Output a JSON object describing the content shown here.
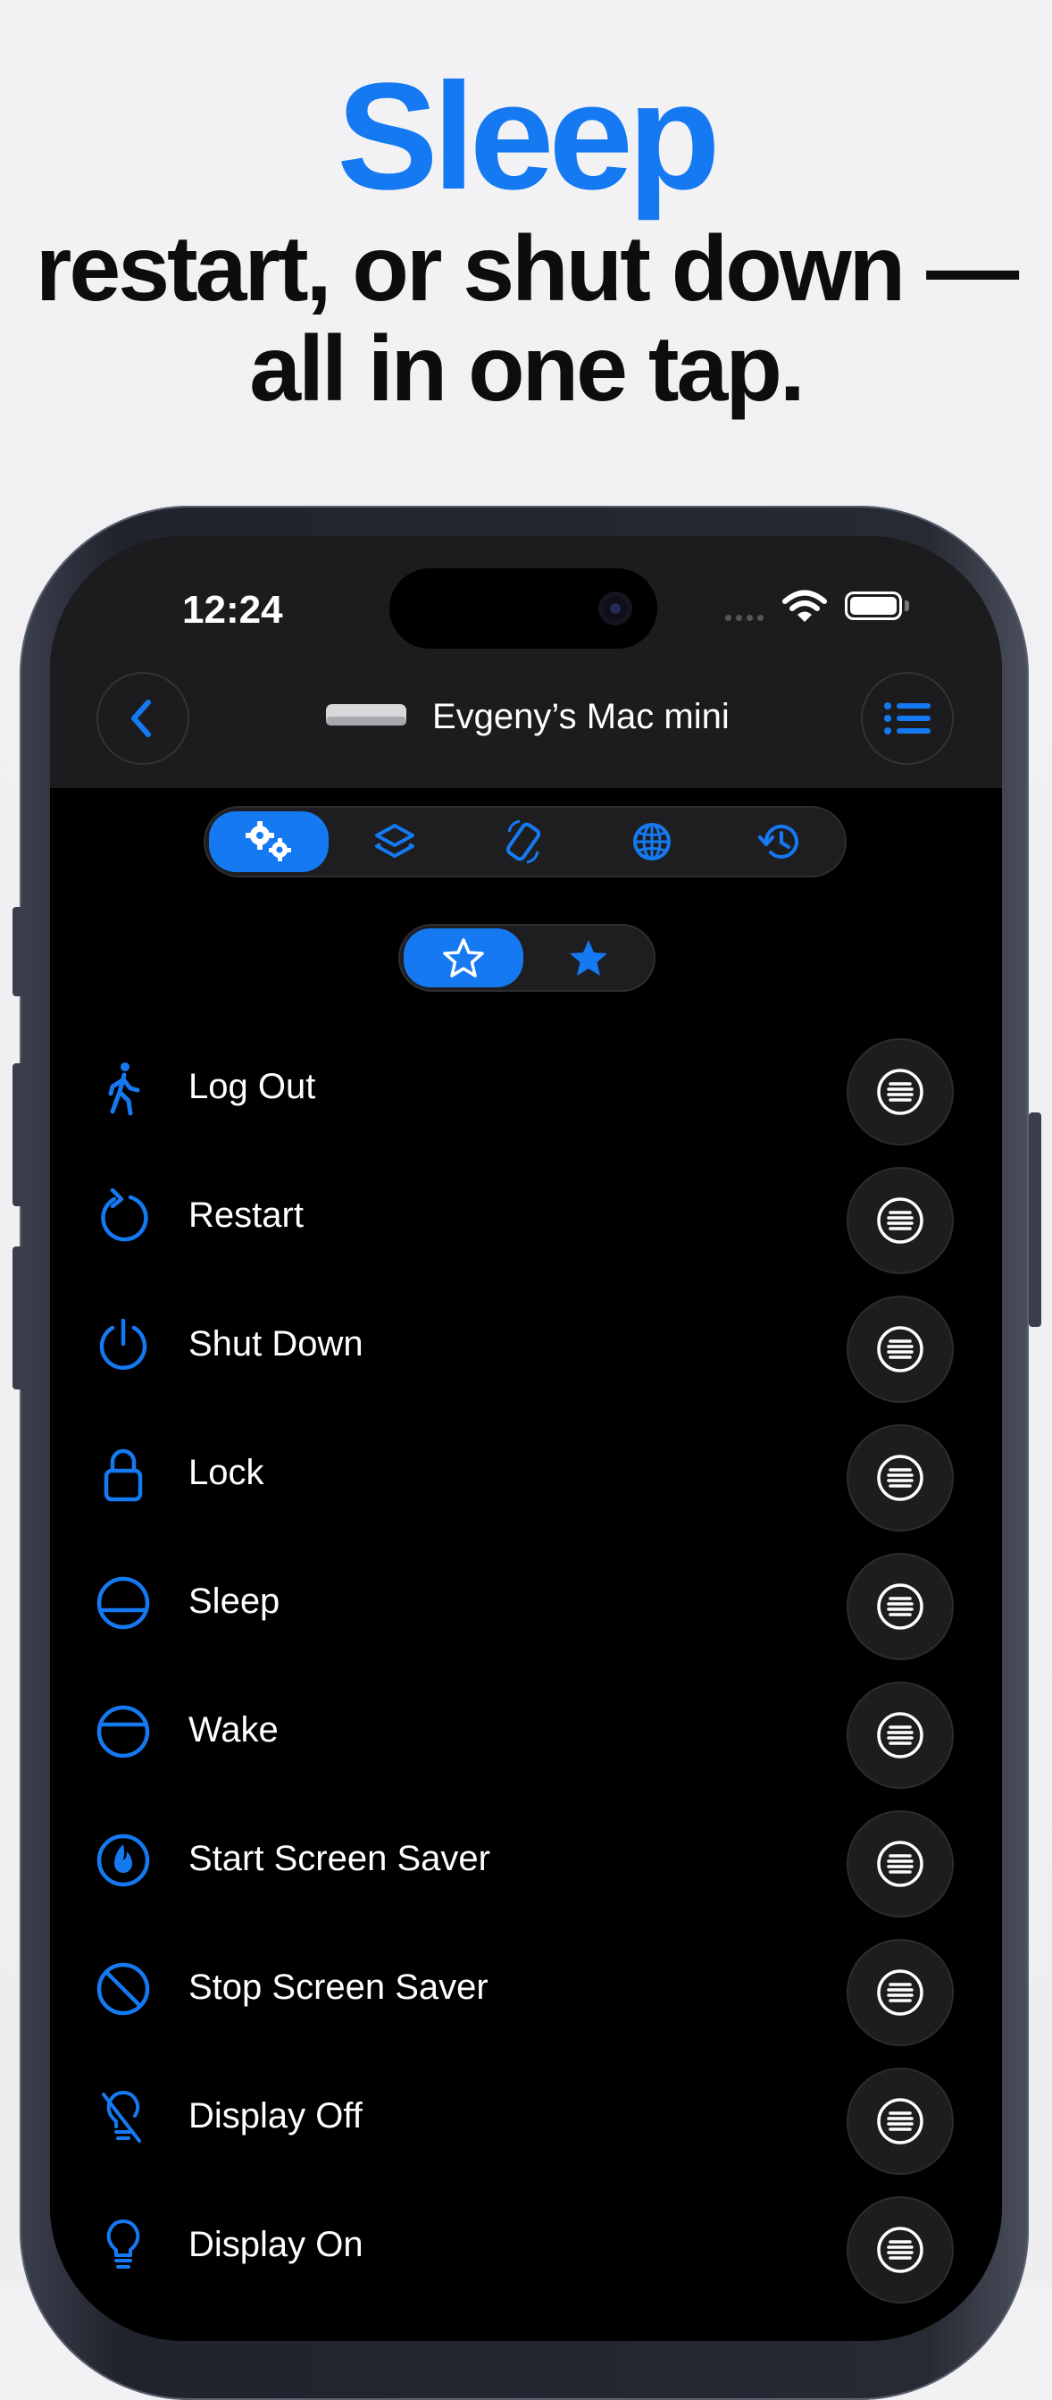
{
  "headline": {
    "title": "Sleep",
    "subtitle_line1": "restart, or shut down —",
    "subtitle_line2": "all in one tap."
  },
  "status_bar": {
    "time": "12:24",
    "icons": [
      "cellular-signal-icon",
      "wifi-icon",
      "battery-icon"
    ]
  },
  "nav": {
    "back_icon": "chevron-left-icon",
    "device_icon": "mac-mini-icon",
    "device_name": "Evgeny’s Mac mini",
    "menu_icon": "list-icon"
  },
  "tabs": {
    "items": [
      "gears-icon",
      "layers-icon",
      "rotate-device-icon",
      "globe-icon",
      "history-icon"
    ],
    "selected": 0
  },
  "filter": {
    "items": [
      "star-outline-icon",
      "star-filled-icon"
    ],
    "selected": 0
  },
  "actions": [
    {
      "label": "Log Out",
      "icon": "walking-person-icon"
    },
    {
      "label": "Restart",
      "icon": "restart-arrow-icon"
    },
    {
      "label": "Shut Down",
      "icon": "power-icon"
    },
    {
      "label": "Lock",
      "icon": "lock-icon"
    },
    {
      "label": "Sleep",
      "icon": "sleep-circle-icon"
    },
    {
      "label": "Wake",
      "icon": "wake-circle-icon"
    },
    {
      "label": "Start Screen Saver",
      "icon": "flame-icon"
    },
    {
      "label": "Stop Screen Saver",
      "icon": "prohibited-icon"
    },
    {
      "label": "Display Off",
      "icon": "lightbulb-slash-icon"
    },
    {
      "label": "Display On",
      "icon": "lightbulb-icon"
    }
  ],
  "row_menu_icon": "line-list-circle-icon",
  "colors": {
    "accent": "#1579f2",
    "screen_background": "#000000",
    "header_background": "#1c1c1e",
    "page_background": "#f1f1f3"
  }
}
